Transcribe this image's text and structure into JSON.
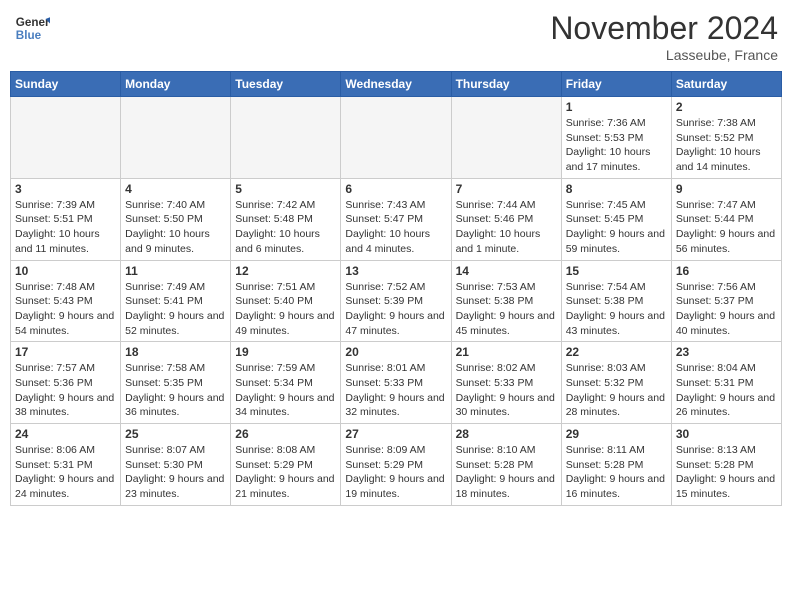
{
  "header": {
    "logo_line1": "General",
    "logo_line2": "Blue",
    "month": "November 2024",
    "location": "Lasseube, France"
  },
  "weekdays": [
    "Sunday",
    "Monday",
    "Tuesday",
    "Wednesday",
    "Thursday",
    "Friday",
    "Saturday"
  ],
  "weeks": [
    [
      {
        "day": "",
        "info": ""
      },
      {
        "day": "",
        "info": ""
      },
      {
        "day": "",
        "info": ""
      },
      {
        "day": "",
        "info": ""
      },
      {
        "day": "",
        "info": ""
      },
      {
        "day": "1",
        "info": "Sunrise: 7:36 AM\nSunset: 5:53 PM\nDaylight: 10 hours and 17 minutes."
      },
      {
        "day": "2",
        "info": "Sunrise: 7:38 AM\nSunset: 5:52 PM\nDaylight: 10 hours and 14 minutes."
      }
    ],
    [
      {
        "day": "3",
        "info": "Sunrise: 7:39 AM\nSunset: 5:51 PM\nDaylight: 10 hours and 11 minutes."
      },
      {
        "day": "4",
        "info": "Sunrise: 7:40 AM\nSunset: 5:50 PM\nDaylight: 10 hours and 9 minutes."
      },
      {
        "day": "5",
        "info": "Sunrise: 7:42 AM\nSunset: 5:48 PM\nDaylight: 10 hours and 6 minutes."
      },
      {
        "day": "6",
        "info": "Sunrise: 7:43 AM\nSunset: 5:47 PM\nDaylight: 10 hours and 4 minutes."
      },
      {
        "day": "7",
        "info": "Sunrise: 7:44 AM\nSunset: 5:46 PM\nDaylight: 10 hours and 1 minute."
      },
      {
        "day": "8",
        "info": "Sunrise: 7:45 AM\nSunset: 5:45 PM\nDaylight: 9 hours and 59 minutes."
      },
      {
        "day": "9",
        "info": "Sunrise: 7:47 AM\nSunset: 5:44 PM\nDaylight: 9 hours and 56 minutes."
      }
    ],
    [
      {
        "day": "10",
        "info": "Sunrise: 7:48 AM\nSunset: 5:43 PM\nDaylight: 9 hours and 54 minutes."
      },
      {
        "day": "11",
        "info": "Sunrise: 7:49 AM\nSunset: 5:41 PM\nDaylight: 9 hours and 52 minutes."
      },
      {
        "day": "12",
        "info": "Sunrise: 7:51 AM\nSunset: 5:40 PM\nDaylight: 9 hours and 49 minutes."
      },
      {
        "day": "13",
        "info": "Sunrise: 7:52 AM\nSunset: 5:39 PM\nDaylight: 9 hours and 47 minutes."
      },
      {
        "day": "14",
        "info": "Sunrise: 7:53 AM\nSunset: 5:38 PM\nDaylight: 9 hours and 45 minutes."
      },
      {
        "day": "15",
        "info": "Sunrise: 7:54 AM\nSunset: 5:38 PM\nDaylight: 9 hours and 43 minutes."
      },
      {
        "day": "16",
        "info": "Sunrise: 7:56 AM\nSunset: 5:37 PM\nDaylight: 9 hours and 40 minutes."
      }
    ],
    [
      {
        "day": "17",
        "info": "Sunrise: 7:57 AM\nSunset: 5:36 PM\nDaylight: 9 hours and 38 minutes."
      },
      {
        "day": "18",
        "info": "Sunrise: 7:58 AM\nSunset: 5:35 PM\nDaylight: 9 hours and 36 minutes."
      },
      {
        "day": "19",
        "info": "Sunrise: 7:59 AM\nSunset: 5:34 PM\nDaylight: 9 hours and 34 minutes."
      },
      {
        "day": "20",
        "info": "Sunrise: 8:01 AM\nSunset: 5:33 PM\nDaylight: 9 hours and 32 minutes."
      },
      {
        "day": "21",
        "info": "Sunrise: 8:02 AM\nSunset: 5:33 PM\nDaylight: 9 hours and 30 minutes."
      },
      {
        "day": "22",
        "info": "Sunrise: 8:03 AM\nSunset: 5:32 PM\nDaylight: 9 hours and 28 minutes."
      },
      {
        "day": "23",
        "info": "Sunrise: 8:04 AM\nSunset: 5:31 PM\nDaylight: 9 hours and 26 minutes."
      }
    ],
    [
      {
        "day": "24",
        "info": "Sunrise: 8:06 AM\nSunset: 5:31 PM\nDaylight: 9 hours and 24 minutes."
      },
      {
        "day": "25",
        "info": "Sunrise: 8:07 AM\nSunset: 5:30 PM\nDaylight: 9 hours and 23 minutes."
      },
      {
        "day": "26",
        "info": "Sunrise: 8:08 AM\nSunset: 5:29 PM\nDaylight: 9 hours and 21 minutes."
      },
      {
        "day": "27",
        "info": "Sunrise: 8:09 AM\nSunset: 5:29 PM\nDaylight: 9 hours and 19 minutes."
      },
      {
        "day": "28",
        "info": "Sunrise: 8:10 AM\nSunset: 5:28 PM\nDaylight: 9 hours and 18 minutes."
      },
      {
        "day": "29",
        "info": "Sunrise: 8:11 AM\nSunset: 5:28 PM\nDaylight: 9 hours and 16 minutes."
      },
      {
        "day": "30",
        "info": "Sunrise: 8:13 AM\nSunset: 5:28 PM\nDaylight: 9 hours and 15 minutes."
      }
    ]
  ]
}
